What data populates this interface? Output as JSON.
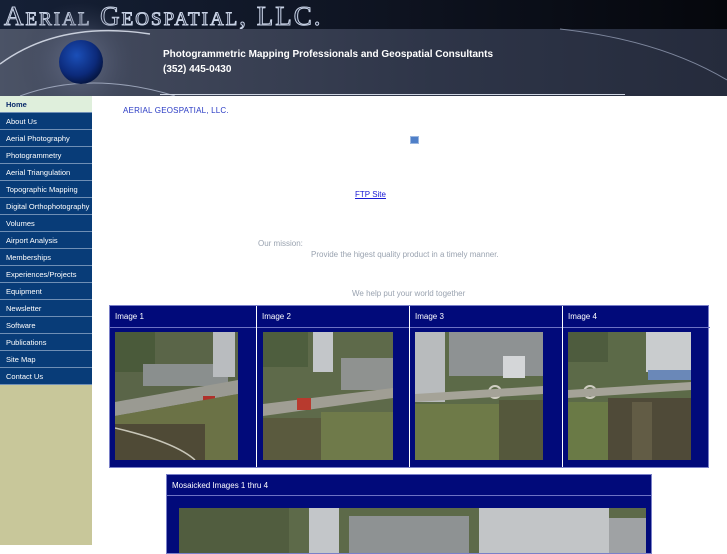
{
  "header": {
    "site_title": "Aerial Geospatial, LLC.",
    "tagline": "Photogrammetric Mapping Professionals and Geospatial Consultants",
    "phone": "(352) 445-0430"
  },
  "nav": {
    "items": [
      {
        "label": "Home",
        "active": true
      },
      {
        "label": "About Us"
      },
      {
        "label": "Aerial Photography"
      },
      {
        "label": "Photogrammetry"
      },
      {
        "label": "Aerial Triangulation"
      },
      {
        "label": "Topographic Mapping"
      },
      {
        "label": "Digital Orthophotography"
      },
      {
        "label": "Volumes"
      },
      {
        "label": "Airport Analysis"
      },
      {
        "label": "Memberships"
      },
      {
        "label": "Experiences/Projects"
      },
      {
        "label": "Equipment"
      },
      {
        "label": "Newsletter"
      },
      {
        "label": "Software"
      },
      {
        "label": "Publications"
      },
      {
        "label": "Site Map"
      },
      {
        "label": "Contact Us"
      }
    ]
  },
  "main": {
    "company_name": "AERIAL GEOSPATIAL, LLC.",
    "ftp_link": "FTP Site",
    "mission_label": "Our mission:",
    "mission_text": "Provide the higest quality product in a timely manner.",
    "slogan": "We help put your world together"
  },
  "images": [
    {
      "label": "Image 1"
    },
    {
      "label": "Image 2"
    },
    {
      "label": "Image 3"
    },
    {
      "label": "Image 4"
    }
  ],
  "mosaic": {
    "label": "Mosaicked Images 1 thru 4"
  },
  "colors": {
    "nav_bg": "#083c78",
    "nav_active_bg": "#dfefdc",
    "sidebar_bg": "#c8c79a",
    "table_bg": "#010a7a",
    "link": "#1a1ad6"
  }
}
